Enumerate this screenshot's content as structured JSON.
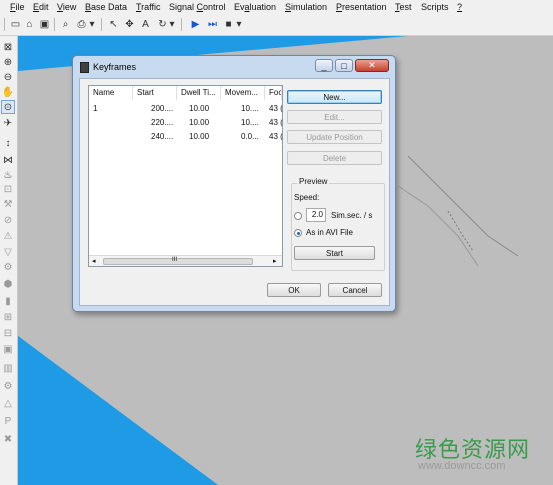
{
  "menu": {
    "items": [
      {
        "pre": "",
        "u": "F",
        "post": "ile"
      },
      {
        "pre": "",
        "u": "E",
        "post": "dit"
      },
      {
        "pre": "",
        "u": "V",
        "post": "iew"
      },
      {
        "pre": "",
        "u": "B",
        "post": "ase Data"
      },
      {
        "pre": "",
        "u": "T",
        "post": "raffic"
      },
      {
        "pre": "Signal ",
        "u": "C",
        "post": "ontrol"
      },
      {
        "pre": "Ev",
        "u": "a",
        "post": "luation"
      },
      {
        "pre": "",
        "u": "S",
        "post": "imulation"
      },
      {
        "pre": "",
        "u": "P",
        "post": "resentation"
      },
      {
        "pre": "",
        "u": "T",
        "post": "est"
      },
      {
        "pre": "Scripts",
        "u": "",
        "post": ""
      },
      {
        "pre": "",
        "u": "?",
        "post": ""
      }
    ]
  },
  "toolbar": {
    "icons": [
      "new-file-icon",
      "open-folder-icon",
      "save-icon",
      "print-preview-icon",
      "print-icon",
      "pointer-icon",
      "link-icon",
      "text-icon",
      "rotate-icon",
      "play-icon",
      "step-icon",
      "stop-icon"
    ]
  },
  "left_toolbar": {
    "icons": [
      "select-icon",
      "zoom-in-icon",
      "zoom-out-icon",
      "pan-icon",
      "camera-icon",
      "vehicle-icon",
      "link-tool-icon",
      "node-icon",
      "signal-icon",
      "parking-icon",
      "road-icon",
      "stop-icon",
      "priority-icon",
      "yield-icon",
      "detector-icon",
      "transit-icon",
      "signal-head-icon",
      "queue-icon",
      "bus-icon",
      "pedestrian-icon",
      "measure-icon",
      "gear-icon",
      "section-icon",
      "parking-lot-icon",
      "close-tool-icon"
    ]
  },
  "dialog": {
    "title": "Keyframes",
    "window_buttons": [
      "_",
      "□",
      "✕"
    ],
    "columns": [
      "Name",
      "Start",
      "Dwell Ti...",
      "Movem...",
      "Foc"
    ],
    "rows": [
      [
        "1",
        "200....",
        "10.00",
        "10....",
        "43 ("
      ],
      [
        "",
        "220....",
        "10.00",
        "10....",
        "43 ("
      ],
      [
        "",
        "240....",
        "10.00",
        "0.0...",
        "43 ("
      ]
    ],
    "scroll_mid": "III",
    "buttons": {
      "new": "New...",
      "edit": "Edit...",
      "update": "Update Position",
      "delete": "Delete",
      "ok": "OK",
      "cancel": "Cancel"
    },
    "preview": {
      "title": "Preview",
      "speed_label": "Speed:",
      "speed_value": "2.0",
      "unit": "Sim.sec. / s",
      "avi_label": "As in AVI File",
      "start": "Start",
      "selected": "avi"
    }
  },
  "watermark": {
    "title": "绿色资源网",
    "url": "www.downcc.com"
  }
}
